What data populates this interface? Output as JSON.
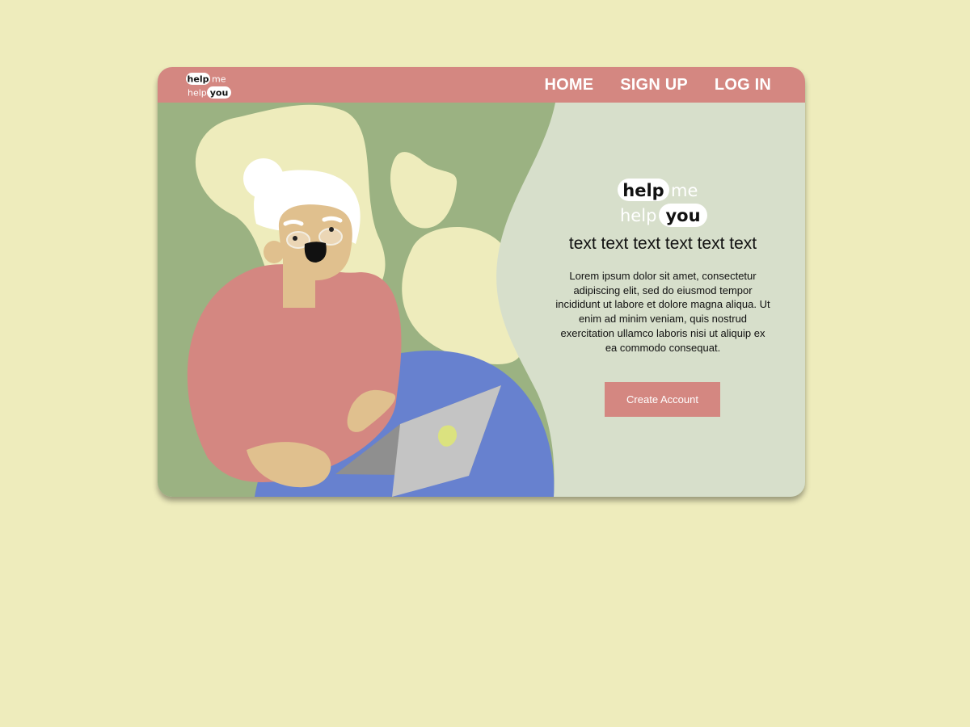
{
  "logo": {
    "line1_word1": "help",
    "line1_word2": "me",
    "line2_word1": "help",
    "line2_word2": "you"
  },
  "nav": {
    "links": [
      "HOME",
      "SIGN UP",
      "LOG IN"
    ]
  },
  "hero": {
    "headline": "text text text text text text",
    "body": "Lorem ipsum dolor sit amet, consectetur adipiscing elit, sed do eiusmod tempor incididunt ut labore et dolore magna aliqua. Ut enim ad minim veniam, quis nostrud exercitation ullamco laboris nisi ut aliquip ex ea commodo consequat.",
    "cta_label": "Create Account"
  },
  "colors": {
    "page_background": "#eeecbc",
    "nav_background": "#d48781",
    "illustration_green": "#9bb282",
    "panel_background": "#d7dfcb",
    "accent_yellow": "#eeecbc",
    "sweater_pink": "#d48781",
    "chair_blue": "#6781cf",
    "button": "#d48781"
  }
}
